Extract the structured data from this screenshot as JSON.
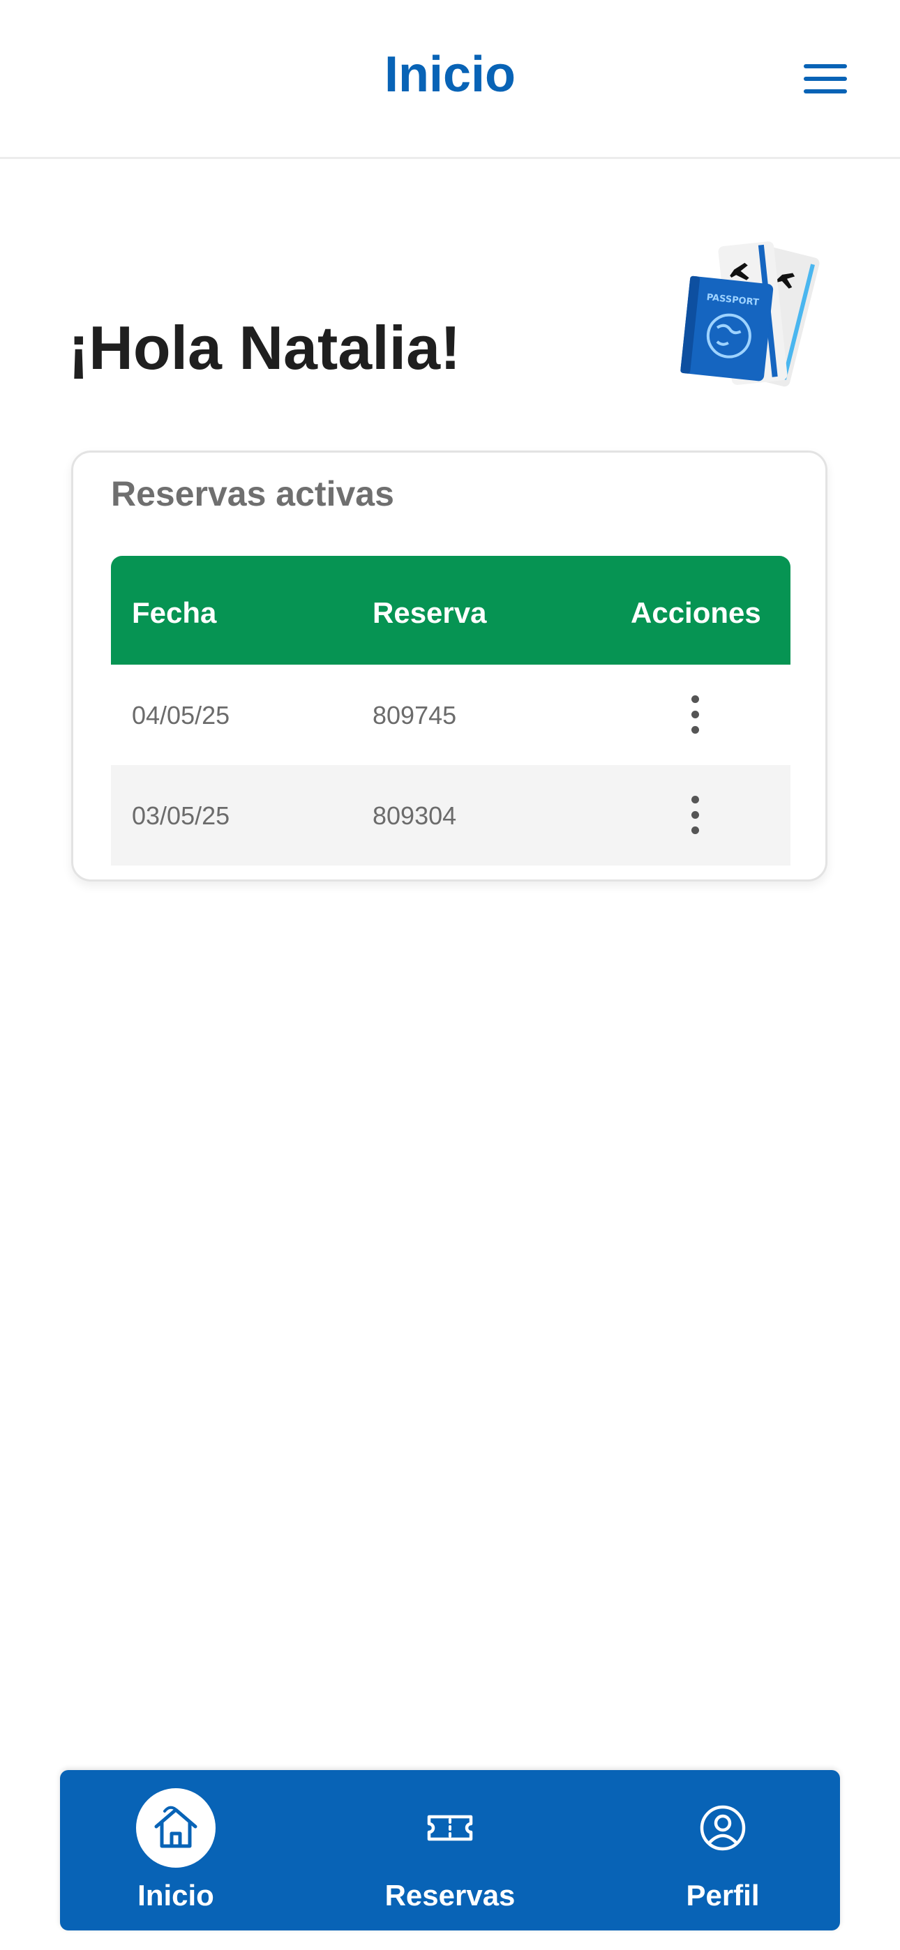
{
  "header": {
    "title": "Inicio",
    "menu_icon": "hamburger-menu-icon"
  },
  "greeting": "¡Hola Natalia!",
  "illustration": {
    "icon": "passport-tickets-illustration",
    "passport_text": "PASSPORT"
  },
  "reservations": {
    "title": "Reservas activas",
    "columns": [
      "Fecha",
      "Reserva",
      "Acciones"
    ],
    "rows": [
      {
        "fecha": "04/05/25",
        "reserva": "809745",
        "action_icon": "more-vertical-icon"
      },
      {
        "fecha": "03/05/25",
        "reserva": "809304",
        "action_icon": "more-vertical-icon"
      }
    ]
  },
  "bottom_nav": {
    "items": [
      {
        "label": "Inicio",
        "icon": "home-icon",
        "active": true
      },
      {
        "label": "Reservas",
        "icon": "ticket-icon",
        "active": false
      },
      {
        "label": "Perfil",
        "icon": "user-circle-icon",
        "active": false
      }
    ]
  },
  "colors": {
    "primary": "#0863b6",
    "table_header": "#069453",
    "alt_row": "#f4f4f4",
    "title_text": "#1f1f1f",
    "muted_text": "#6b6b6b"
  }
}
